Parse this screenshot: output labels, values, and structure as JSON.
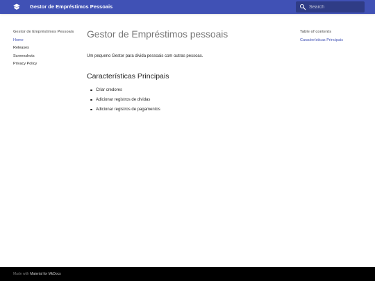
{
  "header": {
    "site_title": "Gestor de Empréstimos Pessoais",
    "logo_icon": "book-icon",
    "search": {
      "placeholder": "Search",
      "icon": "search-icon"
    },
    "background_color": "#4051b5"
  },
  "nav": {
    "title": "Gestor de Empréstimos Pessoais",
    "items": [
      {
        "label": "Home",
        "active": true
      },
      {
        "label": "Releases",
        "active": false
      },
      {
        "label": "Screenshots",
        "active": false
      },
      {
        "label": "Privacy Policy",
        "active": false
      }
    ]
  },
  "main": {
    "title": "Gestor de Empréstimos pessoais",
    "intro": "Um pequeno Gestor para divida pessoais com outras pessoas.",
    "section_title": "Características Principais",
    "features": [
      "Criar credores",
      "Adicionar registros de dividas",
      "Adicionar registros de pagamentos"
    ]
  },
  "toc": {
    "title": "Table of contents",
    "items": [
      "Características Principais"
    ]
  },
  "footer": {
    "made_with": "Made with",
    "link_label": "Material for MkDocs"
  },
  "colors": {
    "primary": "#4051b5",
    "footer_bg": "#000000"
  }
}
